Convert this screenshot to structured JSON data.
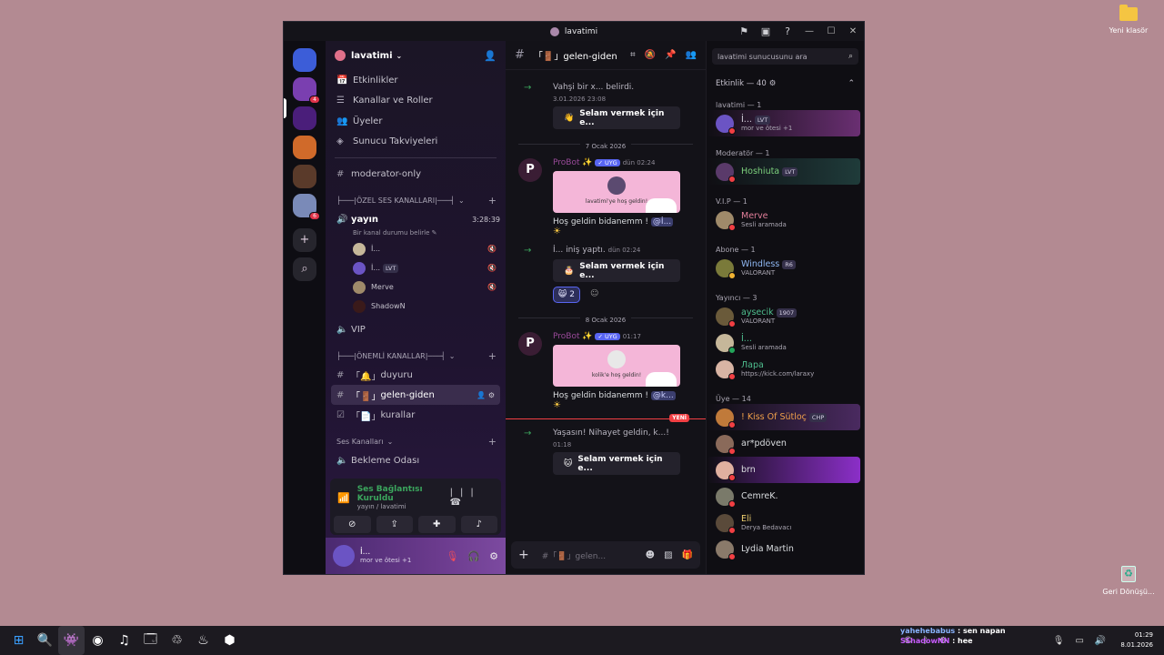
{
  "desktop": {
    "icons": [
      {
        "label": "Yeni klasör"
      },
      {
        "label": "Geri Dönüşü..."
      }
    ]
  },
  "window": {
    "title": "lavatimi",
    "controls": {
      "min": "—",
      "max": "☐",
      "close": "✕"
    }
  },
  "rail": {
    "servers": [
      {
        "color": "#3c5dd8",
        "badge": ""
      },
      {
        "color": "#7a3fb0",
        "badge": "4"
      },
      {
        "color": "#4a1e7a",
        "badge": ""
      },
      {
        "color": "#d06a2a",
        "badge": ""
      },
      {
        "color": "#5a3a2a",
        "badge": ""
      },
      {
        "color": "#7a8ab8",
        "badge": "6"
      }
    ]
  },
  "sidebar": {
    "guild_name": "lavatimi",
    "nav": [
      {
        "label": "Etkinlikler",
        "icon": "📅"
      },
      {
        "label": "Kanallar ve Roller",
        "icon": "☰"
      },
      {
        "label": "Üyeler",
        "icon": "👥"
      },
      {
        "label": "Sunucu Takviyeleri",
        "icon": "◈"
      }
    ],
    "top_channel": "moderator-only",
    "cat_ozel": "├───|ÖZEL SES KANALLARI|───┤",
    "voice_channel": {
      "name": "yayın",
      "timer": "3:28:39",
      "status": "Bir kanal durumu belirle"
    },
    "voice_users": [
      {
        "name": "İ...",
        "tag": "",
        "color": "#c6b79a"
      },
      {
        "name": "İ...",
        "tag": "LVT",
        "color": "#6b54c4"
      },
      {
        "name": "Merve",
        "tag": "",
        "color": "#9f8a6a"
      },
      {
        "name": "ShadowN",
        "tag": "",
        "color": "#3a1a1a"
      }
    ],
    "vip_channel": "VIP",
    "cat_onemli": "├───|ÖNEMLİ KANALLAR|───┤",
    "text_channels": [
      {
        "label": "duyuru",
        "prefix": "「🔔」"
      },
      {
        "label": "gelen-giden",
        "prefix": "「🚪」"
      },
      {
        "label": "kurallar",
        "prefix": "「📄」"
      }
    ],
    "cat_ses": "Ses Kanalları",
    "waiting_room": "Bekleme Odası"
  },
  "voice_panel": {
    "status": "Ses Bağlantısı Kuruldu",
    "location": "yayın / lavatimi"
  },
  "user_panel": {
    "name": "İ...",
    "status": "mor ve ötesi +1"
  },
  "chat": {
    "channel": "「🚪」gelen-giden",
    "placeholder": "#「🚪」gelen...",
    "sys1": {
      "text": "Vahşi bir x... belirdi.",
      "time": "3.01.2026 23:08",
      "button": "Selam vermek için e..."
    },
    "date1": "7 Ocak 2026",
    "bot1": {
      "name": "ProBot ✨",
      "badge": "✓ UYG",
      "time": "dün 02:24",
      "card_caption": "lavatimi'ye hoş geldin!",
      "text": "Hoş geldin bidanemm !",
      "mention": "@İ..."
    },
    "sys2": {
      "text": "İ... iniş yaptı.",
      "time": "dün 02:24",
      "button": "Selam vermek için e..."
    },
    "reaction_count": "2",
    "date2": "8 Ocak 2026",
    "bot2": {
      "name": "ProBot ✨",
      "badge": "✓ UYG",
      "time": "01:17",
      "card_caption": "kolik'e hoş geldin!",
      "text": "Hoş geldin bidanemm !",
      "mention": "@k..."
    },
    "new_label": "YENİ",
    "sys3": {
      "text": "Yaşasın! Nihayet geldin, k...!",
      "time": "01:18",
      "button": "Selam vermek için e..."
    }
  },
  "members": {
    "search_placeholder": "lavatimi sunucusunu ara",
    "activity": "Etkinlik — 40",
    "groups": [
      {
        "title": "lavatimi — 1",
        "members": [
          {
            "name": "İ...",
            "sub": "mor ve ötesi +1",
            "color": "#d8d4e0",
            "av": "#6b54c4",
            "st": "dnd",
            "tag": "LVT",
            "bg": "linear-gradient(90deg, transparent, #6a2f72)"
          }
        ]
      },
      {
        "title": "Moderatör — 1",
        "members": [
          {
            "name": "Hoshiuta",
            "sub": "",
            "color": "#7dd17d",
            "av": "#5a3a6a",
            "st": "dnd",
            "tag": "LVT",
            "bg": "linear-gradient(90deg, transparent, #1f3b3a)"
          }
        ]
      },
      {
        "title": "V.I.P — 1",
        "members": [
          {
            "name": "Merve",
            "sub": "Sesli aramada",
            "color": "#e27f9a",
            "av": "#9f8a6a",
            "st": "dnd",
            "tag": "",
            "bg": ""
          }
        ]
      },
      {
        "title": "Abone — 1",
        "members": [
          {
            "name": "Windless",
            "sub": "VALORANT",
            "color": "#8fb7f2",
            "av": "#7a7a3a",
            "st": "idle",
            "tag": "R6",
            "bg": ""
          }
        ]
      },
      {
        "title": "Yayıncı — 3",
        "members": [
          {
            "name": "aysecik",
            "sub": "VALORANT",
            "color": "#4fbf8f",
            "av": "#6a5a3a",
            "st": "dnd",
            "tag": "1907",
            "bg": ""
          },
          {
            "name": "İ...",
            "sub": "Sesli aramada",
            "color": "#4fbf8f",
            "av": "#c6b79a",
            "st": "on",
            "tag": "",
            "bg": ""
          },
          {
            "name": "Лара",
            "sub": "https://kick.com/laraxy",
            "color": "#4fbf8f",
            "av": "#d8b4a4",
            "st": "dnd",
            "tag": "",
            "bg": ""
          }
        ]
      },
      {
        "title": "Üye — 14",
        "members": [
          {
            "name": "! Kiss Of Sütloç",
            "sub": "",
            "color": "#f0a04a",
            "av": "#c07a3a",
            "st": "dnd",
            "tag": "CHP",
            "bg": "linear-gradient(90deg, transparent, #4a2a60)"
          },
          {
            "name": "ar*pdöven",
            "sub": "",
            "color": "#dbdee1",
            "av": "#8a6a5a",
            "st": "dnd",
            "tag": "",
            "bg": ""
          },
          {
            "name": "brn",
            "sub": "",
            "color": "#dbdee1",
            "av": "#e0b0a0",
            "st": "dnd",
            "tag": "",
            "bg": "linear-gradient(90deg, transparent, #8b2fc8)"
          },
          {
            "name": "CemreK.",
            "sub": "",
            "color": "#dbdee1",
            "av": "#7a7a6a",
            "st": "dnd",
            "tag": "",
            "bg": ""
          },
          {
            "name": "Eli",
            "sub": "Derya Bedavacı",
            "color": "#f0d070",
            "av": "#5a4a3a",
            "st": "dnd",
            "tag": "",
            "bg": ""
          },
          {
            "name": "Lydia Martin",
            "sub": "",
            "color": "#dbdee1",
            "av": "#8a7a6a",
            "st": "dnd",
            "tag": "",
            "bg": ""
          }
        ]
      }
    ]
  },
  "taskbar": {
    "apps": [
      "⊞",
      "🔍",
      "👾",
      "◉",
      "♫",
      "🗔",
      "♲",
      "♨",
      "⬢"
    ],
    "chat_overlay": [
      {
        "user": "yahehebabus",
        "msg": ": sen napan"
      },
      {
        "user": "SShadowNN",
        "msg": ": hee"
      }
    ],
    "time": "01:29",
    "date": "8.01.2026"
  }
}
